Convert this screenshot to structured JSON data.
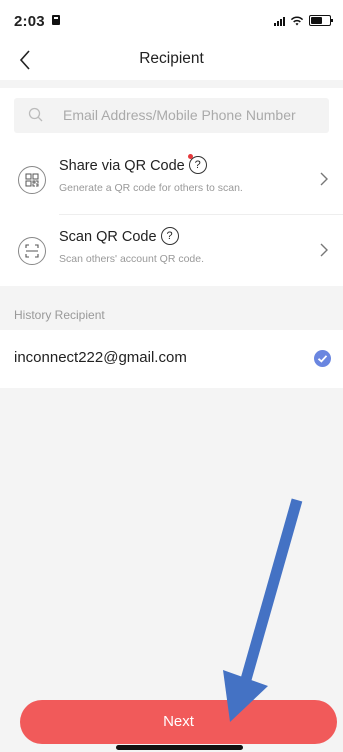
{
  "status_bar": {
    "time": "2:03"
  },
  "nav": {
    "title": "Recipient",
    "back_icon": "chevron-left-icon"
  },
  "search": {
    "placeholder": "Email Address/Mobile Phone Number",
    "icon": "search-icon"
  },
  "rows": [
    {
      "title": "Share via QR Code",
      "subtitle": "Generate a QR code for others to scan.",
      "icon": "qr-code-icon",
      "has_help": true,
      "has_red_dot": true
    },
    {
      "title": "Scan QR Code",
      "subtitle": "Scan others' account QR code.",
      "icon": "scan-icon",
      "has_help": true,
      "has_red_dot": false
    }
  ],
  "history": {
    "label": "History Recipient",
    "items": [
      {
        "email": "inconnect222@gmail.com",
        "selected": true
      }
    ]
  },
  "help_glyph": "?",
  "next_button": {
    "label": "Next"
  },
  "colors": {
    "accent": "#f15a5a",
    "check": "#6a86e0",
    "annotation_arrow": "#4472c4"
  }
}
